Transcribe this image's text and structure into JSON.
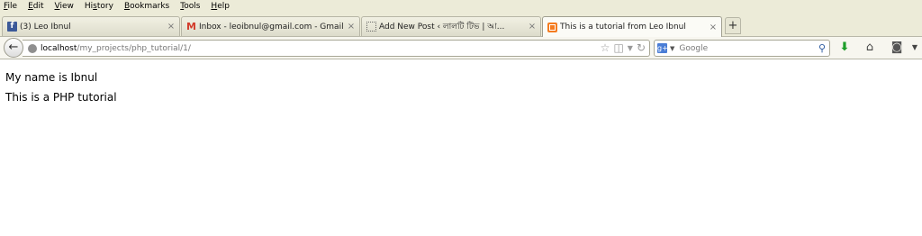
{
  "menu": [
    "File",
    "Edit",
    "View",
    "History",
    "Bookmarks",
    "Tools",
    "Help"
  ],
  "menu_underline": [
    "F",
    "E",
    "V",
    "s",
    "B",
    "T",
    "H"
  ],
  "tabs": [
    {
      "label": "(3) Leo Ibnul",
      "icon": "facebook-icon",
      "active": false
    },
    {
      "label": "Inbox - leoibnul@gmail.com - Gmail",
      "icon": "gmail-icon",
      "active": false
    },
    {
      "label": "Add New Post ‹ লালটি টিভ | আ...",
      "icon": "blank-page-icon",
      "active": false
    },
    {
      "label": "This is a tutorial from Leo Ibnul",
      "icon": "xampp-icon",
      "active": true
    }
  ],
  "url": {
    "host": "localhost",
    "path": "/my_projects/php_tutorial/1/"
  },
  "search": {
    "engine": "Google",
    "placeholder": "Google"
  },
  "page": {
    "lines": [
      "My name is Ibnul",
      "This is a PHP tutorial"
    ]
  }
}
